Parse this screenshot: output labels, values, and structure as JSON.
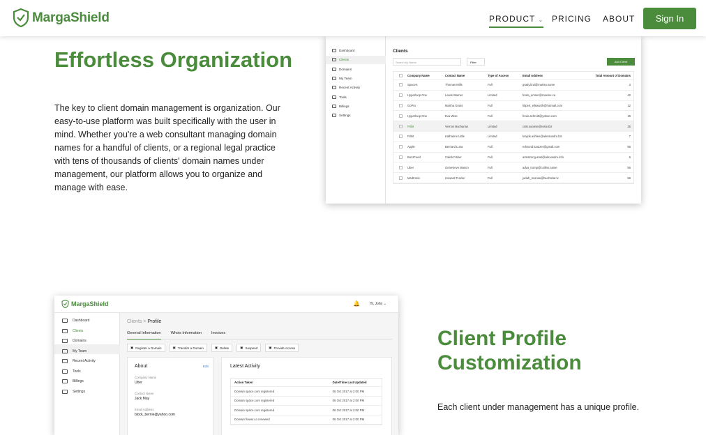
{
  "nav": {
    "brand": "MargaShield",
    "items": [
      "PRODUCT",
      "PRICING",
      "ABOUT"
    ],
    "signin": "Sign In"
  },
  "section1": {
    "title": "Effortless Organization",
    "body": "The key to client domain management is organization. Our easy-to-use platform was built specifically with the user in mind. Whether you're a web consultant managing domain names for a handful of clients, or a regional legal practice with tens of thousands of clients' domain names under management, our platform allows you to organize and manage with ease."
  },
  "section2": {
    "title": "Client Profile Customization",
    "body": "Each client under management has a unique profile."
  },
  "shot1": {
    "sidebar": [
      "Dashboard",
      "Clients",
      "Domains",
      "My Team",
      "Recent Activity",
      "Tools",
      "Billings",
      "Settings"
    ],
    "title": "Clients",
    "search_placeholder": "Search by Name",
    "filter": "Filter",
    "add": "Add Client",
    "columns": [
      "Company Name",
      "Contact Name",
      "Type of Access",
      "Email Address",
      "Total Amount of Domains"
    ],
    "rows": [
      [
        "SpaceX",
        "Thomas Mills",
        "Full",
        "grady.lind@marisa.name",
        "3"
      ],
      [
        "Hyperloop One",
        "Lewis Warner",
        "Limited",
        "freda_ernser@maxine.ca",
        "42"
      ],
      [
        "GoPro",
        "Martha Gross",
        "Full",
        "hilpert_ellsworth@hotmail.com",
        "12"
      ],
      [
        "Hyperloop One",
        "Eva Wise",
        "Full",
        "freda.schmitt@yahoo.com",
        "15"
      ],
      [
        "Fitbit",
        "Vernon Buchanan",
        "Limited",
        "crist.naomie@rosie.biz",
        "25"
      ],
      [
        "Fitbit",
        "Katharine Little",
        "Limited",
        "krajcik.ashlee@alessandro.biz",
        "7"
      ],
      [
        "Apple",
        "Bernard Luna",
        "Full",
        "edmond.kautzer@gmail.com",
        "56"
      ],
      [
        "BuzzFeed",
        "Caleb Fisher",
        "Full",
        "armstrong.arad@alexandre.info",
        "6"
      ],
      [
        "Uber",
        "Genevieve Mason",
        "Full",
        "adva_tromp@collins.name",
        "56"
      ],
      [
        "Medtronic",
        "Howard Frazier",
        "Full",
        "judah_monow@bechtelar.tv",
        "56"
      ]
    ]
  },
  "shot2": {
    "brand": "MargaShield",
    "user": "Hi, John",
    "sidebar": [
      "Dashboard",
      "Clients",
      "Domains",
      "My Team",
      "Recent Activity",
      "Tools",
      "Billings",
      "Settings"
    ],
    "crumb_parent": "Clients",
    "crumb_sep": " > ",
    "crumb_current": "Profile",
    "tabs": [
      "General Information",
      "Whois Information",
      "Invoices"
    ],
    "actions": [
      "Register a Domain",
      "Transfer a Domain",
      "Delete",
      "Suspend",
      "Provide Access"
    ],
    "about_title": "About",
    "edit": "Edit",
    "fields": [
      {
        "label": "Company Name",
        "value": "Uber"
      },
      {
        "label": "Contact Name",
        "value": "Jack May"
      },
      {
        "label": "Email Address",
        "value": "block_bernie@yahoo.com"
      }
    ],
    "activity_title": "Latest Activity",
    "activity_cols": [
      "Action Taken",
      "Date/Time Last Updated"
    ],
    "activity_rows": [
      [
        "Domain space.com registered",
        "06 Oct 2017 at 2:00 PM"
      ],
      [
        "Domain space.com registered",
        "06 Oct 2017 at 2:00 PM"
      ],
      [
        "Domain space.com registered",
        "06 Oct 2017 at 2:00 PM"
      ],
      [
        "Domain flower.co renewed",
        "06 Oct 2017 at 2:00 PM"
      ]
    ]
  }
}
